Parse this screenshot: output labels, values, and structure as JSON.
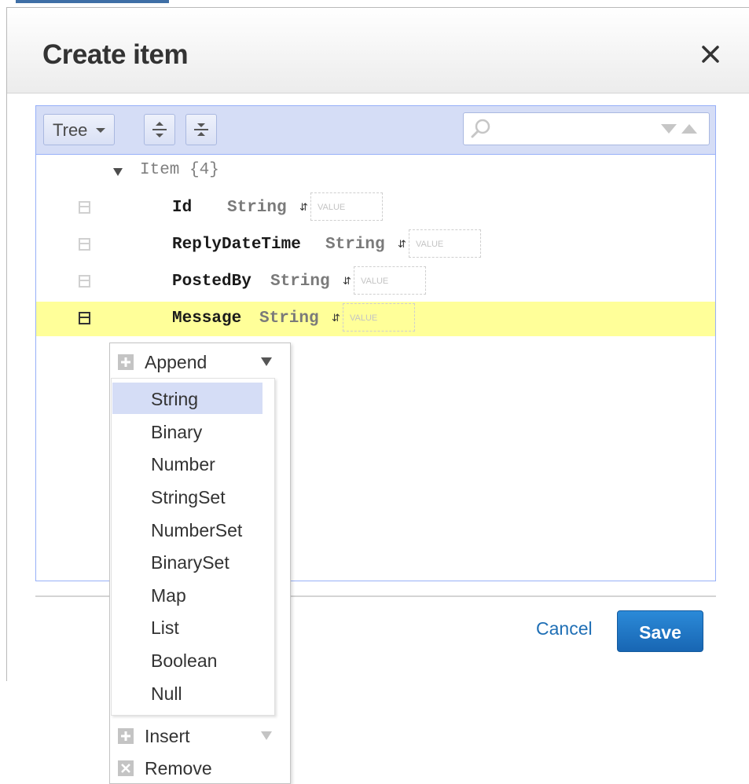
{
  "dialog": {
    "title": "Create item"
  },
  "toolbar": {
    "mode_label": "Tree",
    "search_placeholder": ""
  },
  "tree": {
    "root_label": "Item {4}",
    "rows": [
      {
        "field": "Id",
        "type": "String",
        "value_placeholder": "VALUE"
      },
      {
        "field": "ReplyDateTime",
        "type": "String",
        "value_placeholder": "VALUE"
      },
      {
        "field": "PostedBy",
        "type": "String",
        "value_placeholder": "VALUE"
      },
      {
        "field": "Message",
        "type": "String",
        "value_placeholder": "VALUE",
        "highlighted": true
      }
    ]
  },
  "context_menu": {
    "append_label": "Append",
    "insert_label": "Insert",
    "remove_label": "Remove",
    "types": [
      "String",
      "Binary",
      "Number",
      "StringSet",
      "NumberSet",
      "BinarySet",
      "Map",
      "List",
      "Boolean",
      "Null"
    ],
    "selected_type": "String"
  },
  "footer": {
    "cancel_label": "Cancel",
    "save_label": "Save"
  },
  "colors": {
    "accent": "#1a6fc4",
    "highlight_row": "#ffff99",
    "menubar": "#d5ddf6",
    "editor_border": "#97b0f8"
  }
}
